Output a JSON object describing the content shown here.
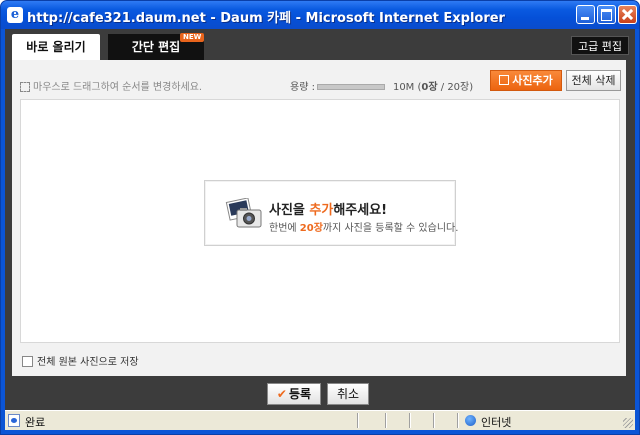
{
  "window": {
    "title": "http://cafe321.daum.net - Daum 카페 - Microsoft Internet Explorer"
  },
  "tabs": {
    "quick_upload": "바로 올리기",
    "simple_edit": "간단 편집",
    "new_badge": "NEW",
    "advanced_edit": "고급 편집"
  },
  "toolbar": {
    "drag_hint": "마우스로 드래그하여 순서를 변경하세요.",
    "capacity_label": "용량 :",
    "capacity_used_fraction": 0,
    "capacity_max": "10M",
    "count_open": "(",
    "count_current": "0장",
    "count_sep": " / ",
    "count_max": "20장",
    "count_close": ")",
    "add_photo": "사진추가",
    "delete_all": "전체 삭제"
  },
  "placeholder": {
    "title_pre": "사진을 ",
    "title_accent": "추가",
    "title_post": "해주세요!",
    "sub_pre": "한번에 ",
    "sub_accent": "20장",
    "sub_post": "까지 사진을 등록할 수 있습니다."
  },
  "options": {
    "save_original": "전체 원본 사진으로 저장",
    "save_original_checked": false
  },
  "actions": {
    "register": "등록",
    "cancel": "취소"
  },
  "statusbar": {
    "status": "완료",
    "zone": "인터넷"
  },
  "colors": {
    "accent": "#ee6a1e",
    "titlebar": "#0a5ae0"
  }
}
